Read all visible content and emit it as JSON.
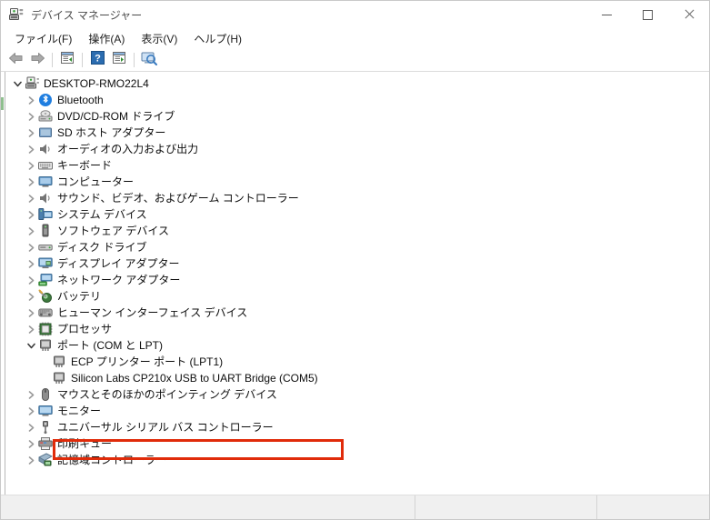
{
  "window": {
    "title": "デバイス マネージャー",
    "title_icon": "device-manager-icon",
    "controls": {
      "minimize": "最小化",
      "maximize": "最大化",
      "close": "閉じる"
    }
  },
  "menubar": {
    "items": [
      {
        "label": "ファイル(F)",
        "name": "menu-file"
      },
      {
        "label": "操作(A)",
        "name": "menu-action"
      },
      {
        "label": "表示(V)",
        "name": "menu-view"
      },
      {
        "label": "ヘルプ(H)",
        "name": "menu-help"
      }
    ]
  },
  "toolbar": {
    "buttons": [
      {
        "icon": "back-arrow-icon",
        "name": "toolbar-back"
      },
      {
        "icon": "forward-arrow-icon",
        "name": "toolbar-forward"
      },
      {
        "icon": "properties-icon",
        "name": "toolbar-properties"
      },
      {
        "icon": "help-icon",
        "name": "toolbar-help"
      },
      {
        "icon": "scan-hardware-icon",
        "name": "toolbar-scan-hardware"
      },
      {
        "icon": "update-driver-icon",
        "name": "toolbar-update-driver"
      }
    ]
  },
  "tree": {
    "root": {
      "label": "DESKTOP-RMO22L4",
      "icon": "computer-root-icon",
      "expanded": true
    },
    "nodes": [
      {
        "label": "Bluetooth",
        "icon": "bluetooth-icon",
        "depth": 1,
        "expanded": false
      },
      {
        "label": "DVD/CD-ROM ドライブ",
        "icon": "dvd-drive-icon",
        "depth": 1,
        "expanded": false
      },
      {
        "label": "SD ホスト アダプター",
        "icon": "sd-host-adapter-icon",
        "depth": 1,
        "expanded": false
      },
      {
        "label": "オーディオの入力および出力",
        "icon": "audio-icon",
        "depth": 1,
        "expanded": false
      },
      {
        "label": "キーボード",
        "icon": "keyboard-icon",
        "depth": 1,
        "expanded": false
      },
      {
        "label": "コンピューター",
        "icon": "computer-icon",
        "depth": 1,
        "expanded": false
      },
      {
        "label": "サウンド、ビデオ、およびゲーム コントローラー",
        "icon": "sound-video-game-icon",
        "depth": 1,
        "expanded": false
      },
      {
        "label": "システム デバイス",
        "icon": "system-devices-icon",
        "depth": 1,
        "expanded": false
      },
      {
        "label": "ソフトウェア デバイス",
        "icon": "software-device-icon",
        "depth": 1,
        "expanded": false
      },
      {
        "label": "ディスク ドライブ",
        "icon": "disk-drive-icon",
        "depth": 1,
        "expanded": false
      },
      {
        "label": "ディスプレイ アダプター",
        "icon": "display-adapter-icon",
        "depth": 1,
        "expanded": false
      },
      {
        "label": "ネットワーク アダプター",
        "icon": "network-adapter-icon",
        "depth": 1,
        "expanded": false
      },
      {
        "label": "バッテリ",
        "icon": "battery-icon",
        "depth": 1,
        "expanded": false
      },
      {
        "label": "ヒューマン インターフェイス デバイス",
        "icon": "hid-icon",
        "depth": 1,
        "expanded": false
      },
      {
        "label": "プロセッサ",
        "icon": "processor-icon",
        "depth": 1,
        "expanded": false
      },
      {
        "label": "ポート (COM と LPT)",
        "icon": "ports-icon",
        "depth": 1,
        "expanded": true
      },
      {
        "label": "ECP プリンター ポート (LPT1)",
        "icon": "port-device-icon",
        "depth": 2,
        "expanded": false
      },
      {
        "label": "Silicon Labs CP210x USB to UART Bridge (COM5)",
        "icon": "port-device-icon",
        "depth": 2,
        "expanded": false,
        "highlighted": true
      },
      {
        "label": "マウスとそのほかのポインティング デバイス",
        "icon": "mouse-icon",
        "depth": 1,
        "expanded": false
      },
      {
        "label": "モニター",
        "icon": "monitor-icon",
        "depth": 1,
        "expanded": false
      },
      {
        "label": "ユニバーサル シリアル バス コントローラー",
        "icon": "usb-controller-icon",
        "depth": 1,
        "expanded": false
      },
      {
        "label": "印刷キュー",
        "icon": "print-queue-icon",
        "depth": 1,
        "expanded": false
      },
      {
        "label": "記憶域コントローラー",
        "icon": "storage-controller-icon",
        "depth": 1,
        "expanded": false
      }
    ]
  },
  "annotation": {
    "color": "#e02b0a",
    "target": "Silicon Labs CP210x USB to UART Bridge (COM5)"
  },
  "statusbar": {
    "segments": [
      "",
      "",
      ""
    ]
  }
}
